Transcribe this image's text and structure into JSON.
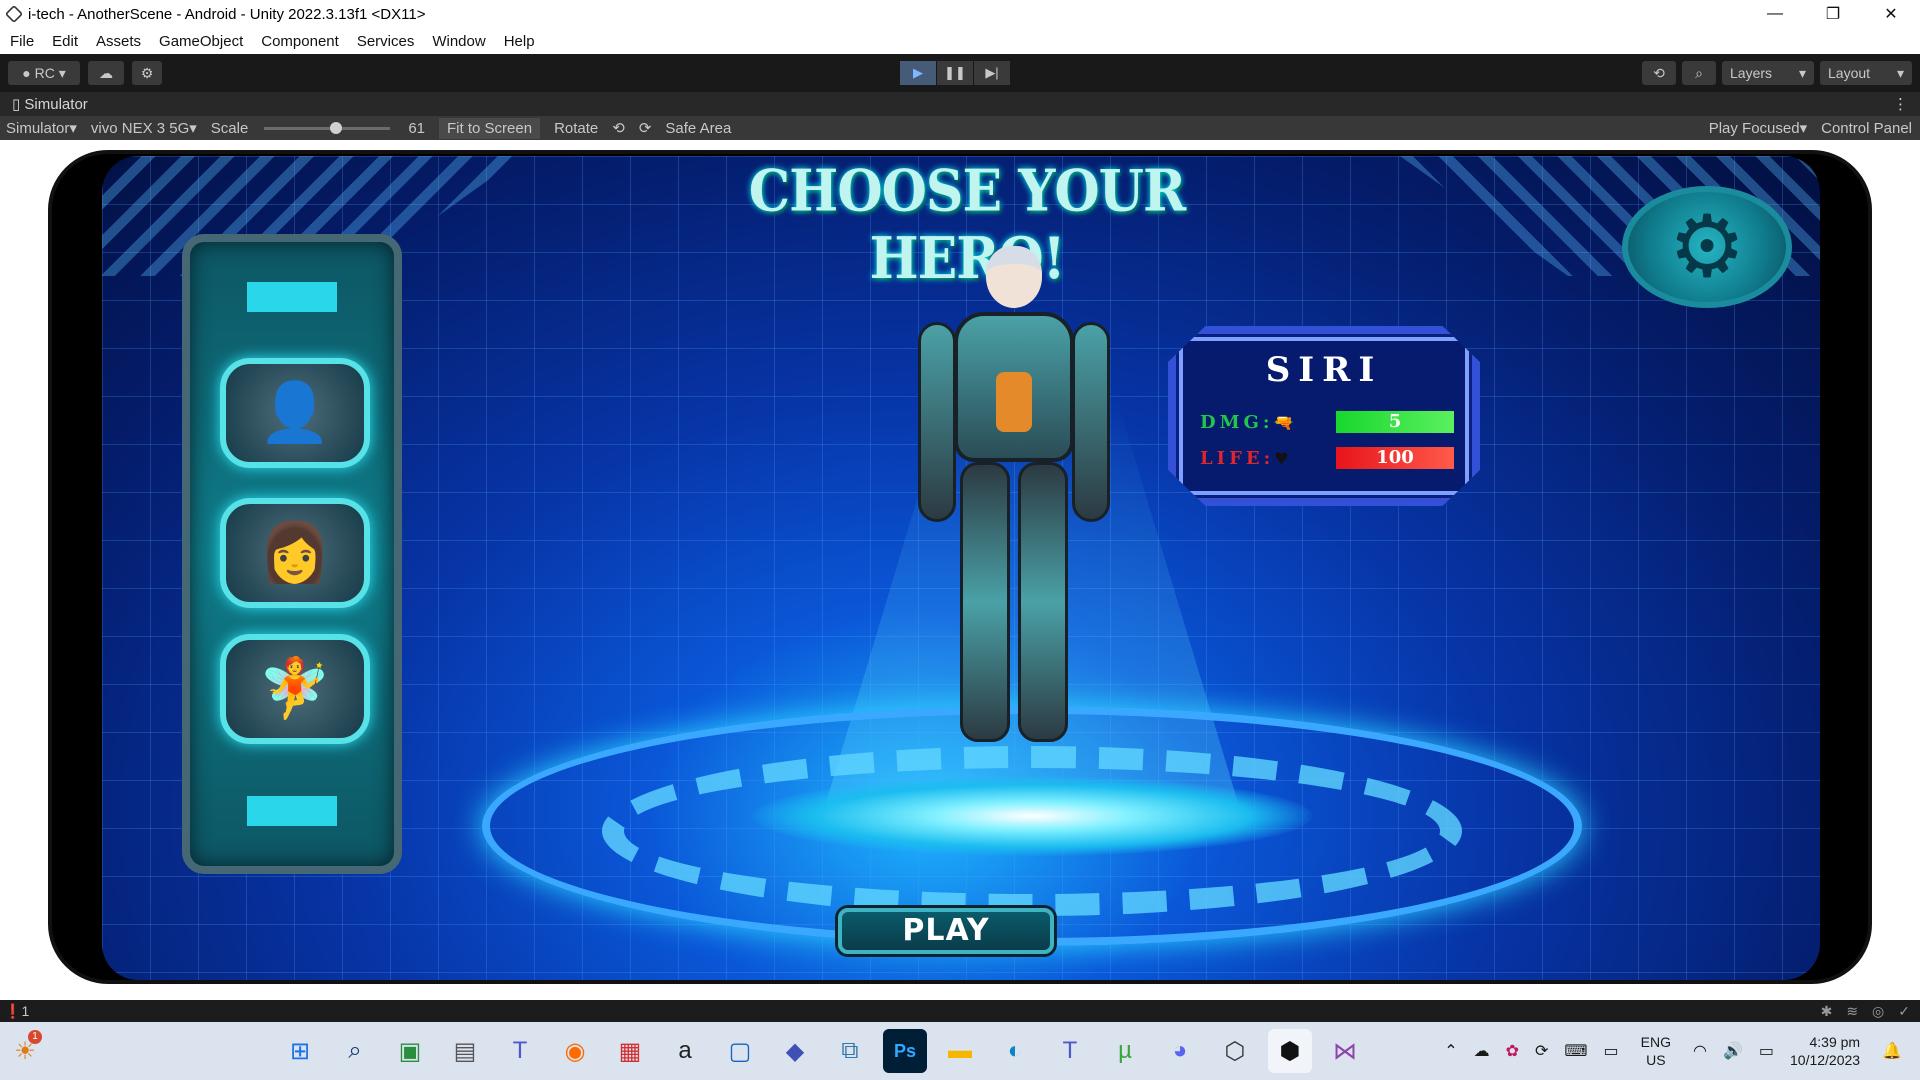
{
  "window": {
    "title": "i-tech - AnotherScene - Android - Unity 2022.3.13f1 <DX11>",
    "minimize": "—",
    "restore": "❐",
    "close": "✕"
  },
  "menu": [
    "File",
    "Edit",
    "Assets",
    "GameObject",
    "Component",
    "Services",
    "Window",
    "Help"
  ],
  "toolbar": {
    "account": "RC",
    "play": "▶",
    "pause": "❚❚",
    "step": "▶|",
    "history_icon": "history-icon",
    "search_icon": "search-icon",
    "layers": "Layers",
    "layout": "Layout"
  },
  "simulator": {
    "tab": "Simulator",
    "mode": "Simulator",
    "device": "vivo NEX 3 5G",
    "scale_label": "Scale",
    "scale_value": "61",
    "scale_fraction": 0.55,
    "fit": "Fit to Screen",
    "rotate": "Rotate",
    "safe_area": "Safe Area",
    "play_focused": "Play Focused",
    "control_panel": "Control Panel"
  },
  "game": {
    "title": "CHOOSE YOUR HERO!",
    "hero_name": "SIRI",
    "dmg_label": "DMG:",
    "dmg_value": "5",
    "life_label": "LIFE:",
    "life_value": "100",
    "play_button": "PLAY",
    "heroes": [
      "hero-1-portrait",
      "hero-2-portrait",
      "hero-3-portrait"
    ]
  },
  "status": {
    "count": "1"
  },
  "taskbar": {
    "notification_badge": "1",
    "lang_top": "ENG",
    "lang_bottom": "US",
    "time": "4:39 pm",
    "date": "10/12/2023",
    "apps": [
      "windows-start",
      "search",
      "app-icon",
      "file-manager",
      "teams",
      "firefox",
      "store",
      "amazon",
      "app",
      "paint",
      "python",
      "photoshop",
      "explorer",
      "edge",
      "teams-2",
      "utorrent",
      "discord",
      "unity-hub",
      "unity",
      "visual-studio"
    ]
  }
}
